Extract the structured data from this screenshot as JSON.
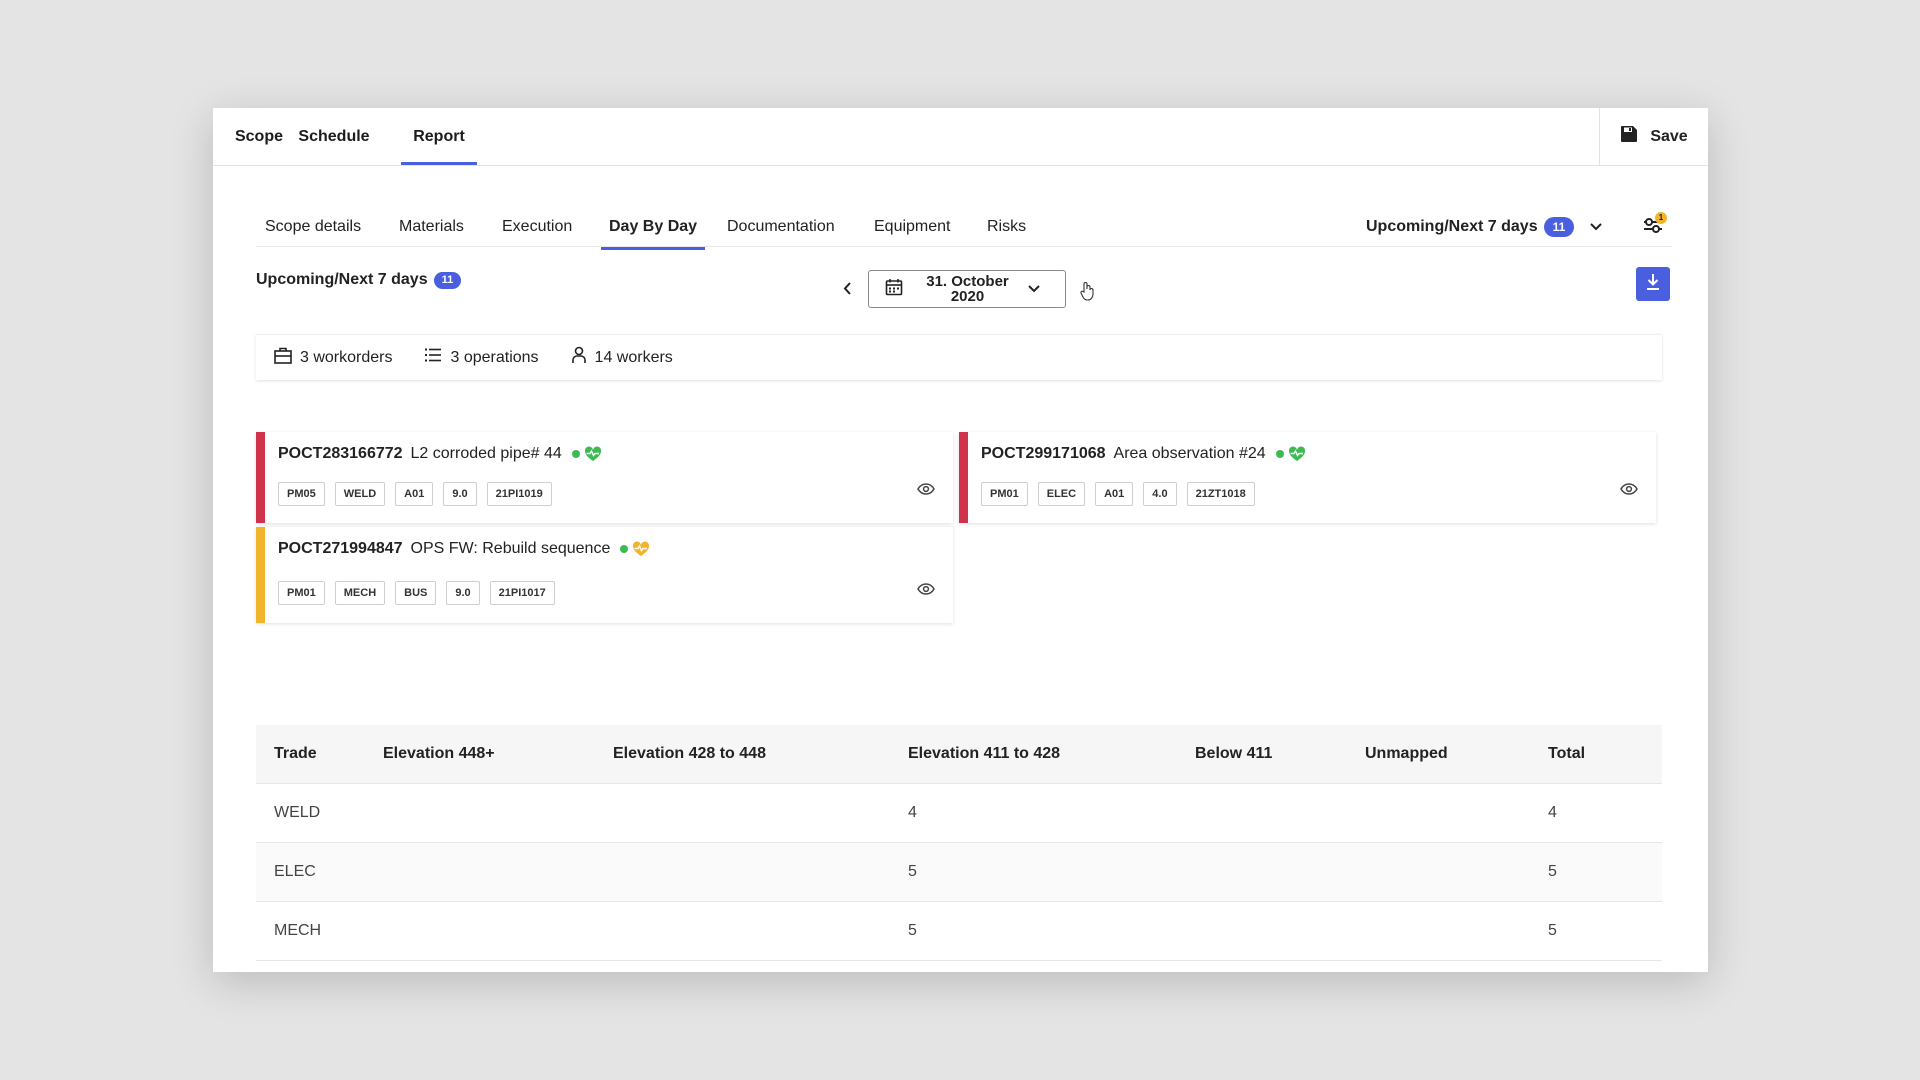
{
  "top_tabs": [
    {
      "label": "Scope"
    },
    {
      "label": "Schedule"
    },
    {
      "label": "Report"
    }
  ],
  "save_label": "Save",
  "sub_tabs": [
    {
      "label": "Scope details"
    },
    {
      "label": "Materials"
    },
    {
      "label": "Execution"
    },
    {
      "label": "Day By Day"
    },
    {
      "label": "Documentation"
    },
    {
      "label": "Equipment"
    },
    {
      "label": "Risks"
    }
  ],
  "active_sub_tab": "Day By Day",
  "period_filter": {
    "label": "Upcoming/Next 7 days",
    "count": "11"
  },
  "filter_notification_count": "1",
  "period_heading": {
    "label": "Upcoming/Next 7 days",
    "count": "11"
  },
  "date_picker": {
    "line1": "31. October",
    "line2": "2020"
  },
  "stats": {
    "workorders": "3 workorders",
    "operations": "3 operations",
    "workers": "14 workers"
  },
  "cards": [
    {
      "id": "POCT283166772",
      "title": "L2 corroded pipe# 44",
      "status_color": "#d0314b",
      "health_color": "#3cba54",
      "tags": [
        "PM05",
        "WELD",
        "A01",
        "9.0",
        "21PI1019"
      ]
    },
    {
      "id": "POCT299171068",
      "title": "Area observation #24",
      "status_color": "#d0314b",
      "health_color": "#3cba54",
      "tags": [
        "PM01",
        "ELEC",
        "A01",
        "4.0",
        "21ZT1018"
      ]
    },
    {
      "id": "POCT271994847",
      "title": "OPS FW: Rebuild sequence",
      "status_color": "#f0b52c",
      "health_color": "#f0b52c",
      "tags": [
        "PM01",
        "MECH",
        "BUS",
        "9.0",
        "21PI1017"
      ]
    }
  ],
  "table": {
    "headers": [
      "Trade",
      "Elevation 448+",
      "Elevation 428 to 448",
      "Elevation 411 to 428",
      "Below 411",
      "Unmapped",
      "Total"
    ],
    "rows": [
      [
        "WELD",
        "",
        "",
        "4",
        "",
        "",
        "4"
      ],
      [
        "ELEC",
        "",
        "",
        "5",
        "",
        "",
        "5"
      ],
      [
        "MECH",
        "",
        "",
        "5",
        "",
        "",
        "5"
      ]
    ]
  },
  "colors": {
    "accent": "#4a5fe0",
    "critical": "#d0314b",
    "warning": "#f0b52c",
    "ok": "#3cba54"
  }
}
